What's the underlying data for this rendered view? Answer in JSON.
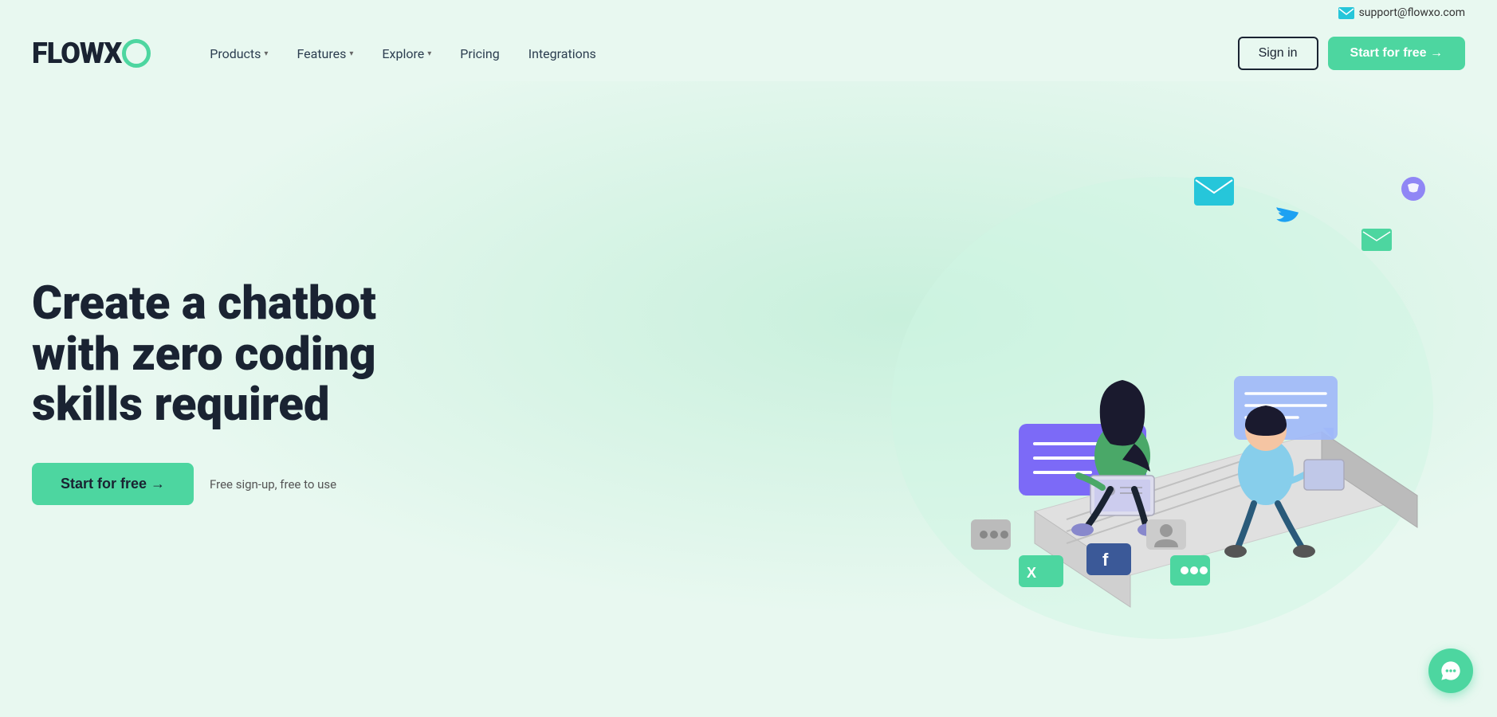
{
  "topbar": {
    "email": "support@flowxo.com",
    "email_icon": "email-icon"
  },
  "nav": {
    "logo_text": "FLOWX",
    "logo_circle_color": "#4dd6a0",
    "items": [
      {
        "label": "Products",
        "has_dropdown": true
      },
      {
        "label": "Features",
        "has_dropdown": true
      },
      {
        "label": "Explore",
        "has_dropdown": true
      },
      {
        "label": "Pricing",
        "has_dropdown": false
      },
      {
        "label": "Integrations",
        "has_dropdown": false
      }
    ],
    "signin_label": "Sign in",
    "start_label": "Start for free →"
  },
  "hero": {
    "headline": "Create a chatbot with zero coding skills required",
    "cta_button": "Start for free →",
    "cta_note": "Free sign-up, free to use"
  },
  "colors": {
    "accent_green": "#4dd6a0",
    "dark_navy": "#1a2332",
    "bg": "#e8f8f0"
  }
}
